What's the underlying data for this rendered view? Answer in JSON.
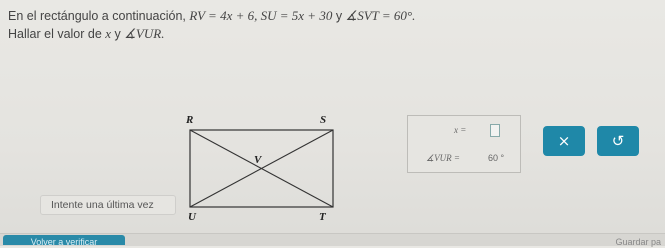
{
  "problem": {
    "line1_text": "En el rectángulo a continuación,",
    "line1_math": "RV = 4x + 6, SU = 5x + 30",
    "line1_mid": "y",
    "line1_angle": "∡SVT = 60°.",
    "line2_text": "Hallar el valor de",
    "line2_var": "x",
    "line2_mid": "y",
    "line2_angle": "∡VUR."
  },
  "figure": {
    "labels": {
      "R": "R",
      "S": "S",
      "V": "V",
      "U": "U",
      "T": "T"
    }
  },
  "answer": {
    "x_label": "x =",
    "angle_label": "∡VUR =",
    "angle_value": "60",
    "degree": "°"
  },
  "buttons": {
    "clear_icon": "×",
    "undo_icon": "↺",
    "try_again": "Intente una última vez",
    "check": "Volver a verificar",
    "save": "Guardar pa"
  },
  "colors": {
    "accent": "#1f88a8"
  }
}
